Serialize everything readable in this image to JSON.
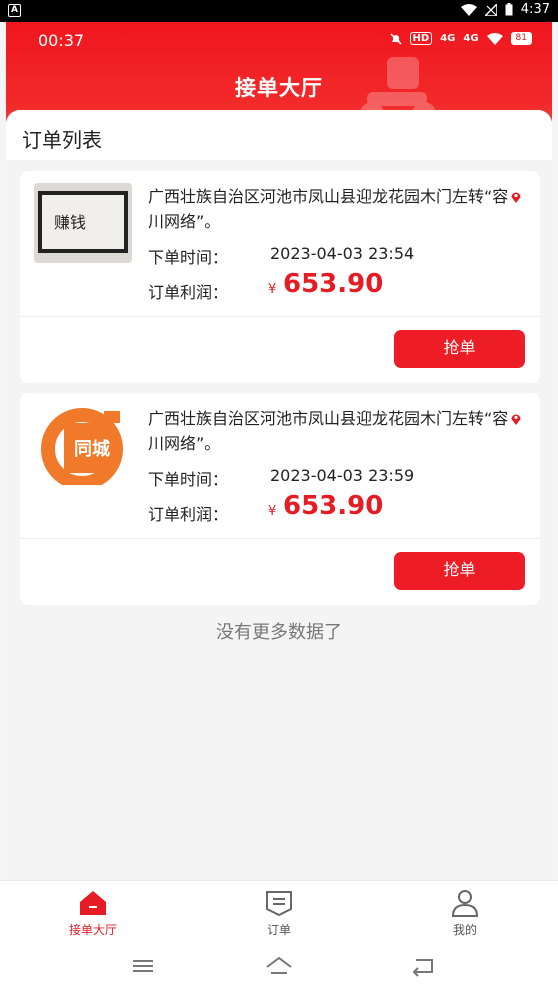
{
  "system_bar": {
    "time": "4:37",
    "app_badge": "A"
  },
  "inner_status": {
    "time": "00:37",
    "net1": "HD",
    "net2": "4G",
    "net3": "4G",
    "battery": "81"
  },
  "header": {
    "title": "接单大厅"
  },
  "panel": {
    "title": "订单列表"
  },
  "orders": [
    {
      "address": "广西壮族自治区河池市凤山县迎龙花园木门左转“容川网络”。",
      "time_label": "下单时间：",
      "time_value": "2023-04-03 23:54",
      "profit_label": "订单利润：",
      "currency": "¥",
      "profit": "653.90",
      "button": "抢单",
      "thumb_text": "赚钱"
    },
    {
      "address": "广西壮族自治区河池市凤山县迎龙花园木门左转“容川网络”。",
      "time_label": "下单时间：",
      "time_value": "2023-04-03 23:59",
      "profit_label": "订单利润：",
      "currency": "¥",
      "profit": "653.90",
      "button": "抢单",
      "thumb_text": "同城"
    }
  ],
  "no_more": "没有更多数据了",
  "bottom_nav": [
    {
      "label": "接单大厅",
      "icon": "home-icon",
      "active": true
    },
    {
      "label": "订单",
      "icon": "order-icon",
      "active": false
    },
    {
      "label": "我的",
      "icon": "user-icon",
      "active": false
    }
  ],
  "colors": {
    "brand_red": "#e51c23",
    "header_red": "#f0161e"
  }
}
